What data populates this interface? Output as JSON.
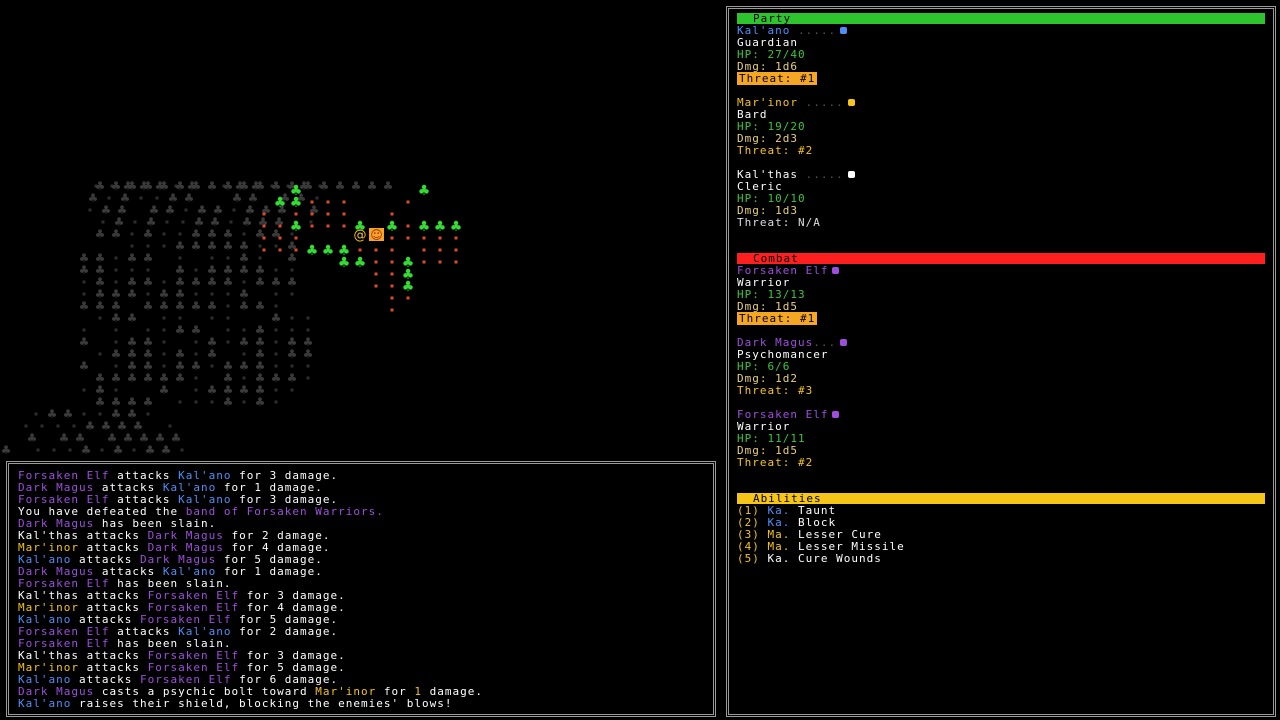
{
  "colors": {
    "kalano": "#4f8ef7",
    "marinor": "#f5c518",
    "kalthas": "#ffffff",
    "enemy": "#9d4edd",
    "party_header": "#2ec42e",
    "combat_header": "#ff1f1f",
    "abilities_header": "#f5c518",
    "threat_badge": "#f5a623"
  },
  "party": {
    "header": "Party",
    "members": [
      {
        "name": "Kal'ano",
        "color": "kalano",
        "role": "Guardian",
        "hp": "HP: 27/40",
        "dmg": "Dmg: 1d6",
        "threat": "Threat: #1",
        "threat_highlight": true
      },
      {
        "name": "Mar'inor",
        "color": "marinor",
        "role": "Bard",
        "hp": "HP: 19/20",
        "dmg": "Dmg: 2d3",
        "threat": "Threat: #2",
        "threat_highlight": false
      },
      {
        "name": "Kal'thas",
        "color": "kalthas",
        "role": "Cleric",
        "hp": "HP: 10/10",
        "dmg": "Dmg: 1d3",
        "threat": "Threat: N/A",
        "threat_highlight": false,
        "threat_na": true
      }
    ]
  },
  "combat": {
    "header": "Combat",
    "enemies": [
      {
        "name": "Forsaken Elf",
        "role": "Warrior",
        "hp": "HP: 13/13",
        "dmg": "Dmg: 1d5",
        "threat": "Threat: #1",
        "threat_highlight": true
      },
      {
        "name": "Dark Magus",
        "role": "Psychomancer",
        "hp": "HP: 6/6",
        "dmg": "Dmg: 1d2",
        "threat": "Threat: #3",
        "threat_highlight": false
      },
      {
        "name": "Forsaken Elf",
        "role": "Warrior",
        "hp": "HP: 11/11",
        "dmg": "Dmg: 1d5",
        "threat": "Threat: #2",
        "threat_highlight": false
      }
    ]
  },
  "abilities": {
    "header": "Abilities",
    "items": [
      {
        "key": "(1)",
        "who": "Ka.",
        "color": "kalano",
        "name": "Taunt"
      },
      {
        "key": "(2)",
        "who": "Ka.",
        "color": "kalano",
        "name": "Block"
      },
      {
        "key": "(3)",
        "who": "Ma.",
        "color": "marinor",
        "name": "Lesser Cure"
      },
      {
        "key": "(4)",
        "who": "Ma.",
        "color": "marinor",
        "name": "Lesser Missile"
      },
      {
        "key": "(5)",
        "who": "Ka.",
        "color": "kalthas",
        "name": "Cure Wounds"
      }
    ]
  },
  "log": [
    [
      [
        "Forsaken Elf",
        "enemy"
      ],
      [
        " attacks ",
        "w"
      ],
      [
        "Kal'ano",
        "kalano"
      ],
      [
        " for 3 damage.",
        "w"
      ]
    ],
    [
      [
        "Dark Magus",
        "enemy"
      ],
      [
        " attacks ",
        "w"
      ],
      [
        "Kal'ano",
        "kalano"
      ],
      [
        " for 1 damage.",
        "w"
      ]
    ],
    [
      [
        "Forsaken Elf",
        "enemy"
      ],
      [
        " attacks ",
        "w"
      ],
      [
        "Kal'ano",
        "kalano"
      ],
      [
        " for 3 damage.",
        "w"
      ]
    ],
    [
      [
        "You have defeated the ",
        "w"
      ],
      [
        "band of Forsaken Warriors.",
        "enemy"
      ]
    ],
    [
      [
        "Dark Magus",
        "enemy"
      ],
      [
        " has been slain.",
        "w"
      ]
    ],
    [
      [
        "Kal'thas",
        "kalthas"
      ],
      [
        " attacks ",
        "w"
      ],
      [
        "Dark Magus",
        "enemy"
      ],
      [
        " for 2 damage.",
        "w"
      ]
    ],
    [
      [
        "Mar'inor",
        "marinor"
      ],
      [
        " attacks ",
        "w"
      ],
      [
        "Dark Magus",
        "enemy"
      ],
      [
        " for 4 damage.",
        "w"
      ]
    ],
    [
      [
        "Kal'ano",
        "kalano"
      ],
      [
        " attacks ",
        "w"
      ],
      [
        "Dark Magus",
        "enemy"
      ],
      [
        " for 5 damage.",
        "w"
      ]
    ],
    [
      [
        "Dark Magus",
        "enemy"
      ],
      [
        " attacks ",
        "w"
      ],
      [
        "Kal'ano",
        "kalano"
      ],
      [
        " for 1 damage.",
        "w"
      ]
    ],
    [
      [
        "Forsaken Elf",
        "enemy"
      ],
      [
        " has been slain.",
        "w"
      ]
    ],
    [
      [
        "Kal'thas",
        "kalthas"
      ],
      [
        " attacks ",
        "w"
      ],
      [
        "Forsaken Elf",
        "enemy"
      ],
      [
        " for 3 damage.",
        "w"
      ]
    ],
    [
      [
        "Mar'inor",
        "marinor"
      ],
      [
        " attacks ",
        "w"
      ],
      [
        "Forsaken Elf",
        "enemy"
      ],
      [
        " for 4 damage.",
        "w"
      ]
    ],
    [
      [
        "Kal'ano",
        "kalano"
      ],
      [
        " attacks ",
        "w"
      ],
      [
        "Forsaken Elf",
        "enemy"
      ],
      [
        " for 5 damage.",
        "w"
      ]
    ],
    [
      [
        "Forsaken Elf",
        "enemy"
      ],
      [
        " attacks ",
        "w"
      ],
      [
        "Kal'ano",
        "kalano"
      ],
      [
        " for 2 damage.",
        "w"
      ]
    ],
    [
      [
        "Forsaken Elf",
        "enemy"
      ],
      [
        " has been slain.",
        "w"
      ]
    ],
    [
      [
        "Kal'thas",
        "kalthas"
      ],
      [
        " attacks ",
        "w"
      ],
      [
        "Forsaken Elf",
        "enemy"
      ],
      [
        " for 3 damage.",
        "w"
      ]
    ],
    [
      [
        "Mar'inor",
        "marinor"
      ],
      [
        " attacks ",
        "w"
      ],
      [
        "Forsaken Elf",
        "enemy"
      ],
      [
        " for 5 damage.",
        "w"
      ]
    ],
    [
      [
        "Kal'ano",
        "kalano"
      ],
      [
        " attacks ",
        "w"
      ],
      [
        "Forsaken Elf",
        "enemy"
      ],
      [
        " for 6 damage.",
        "w"
      ]
    ],
    [
      [
        "Dark Magus",
        "enemy"
      ],
      [
        " casts a psychic bolt toward ",
        "w"
      ],
      [
        "Mar'inor",
        "marinor"
      ],
      [
        " for ",
        "w"
      ],
      [
        "1",
        "marinor"
      ],
      [
        " damage.",
        "w"
      ]
    ],
    [
      [
        "Kal'ano",
        "kalano"
      ],
      [
        " raises their shield, blocking the enemies' blows!",
        "w"
      ]
    ]
  ],
  "map": {
    "glyphs": {
      "tree": "♣",
      "floor": "·",
      "player": "@",
      "party_group": "☺"
    }
  }
}
